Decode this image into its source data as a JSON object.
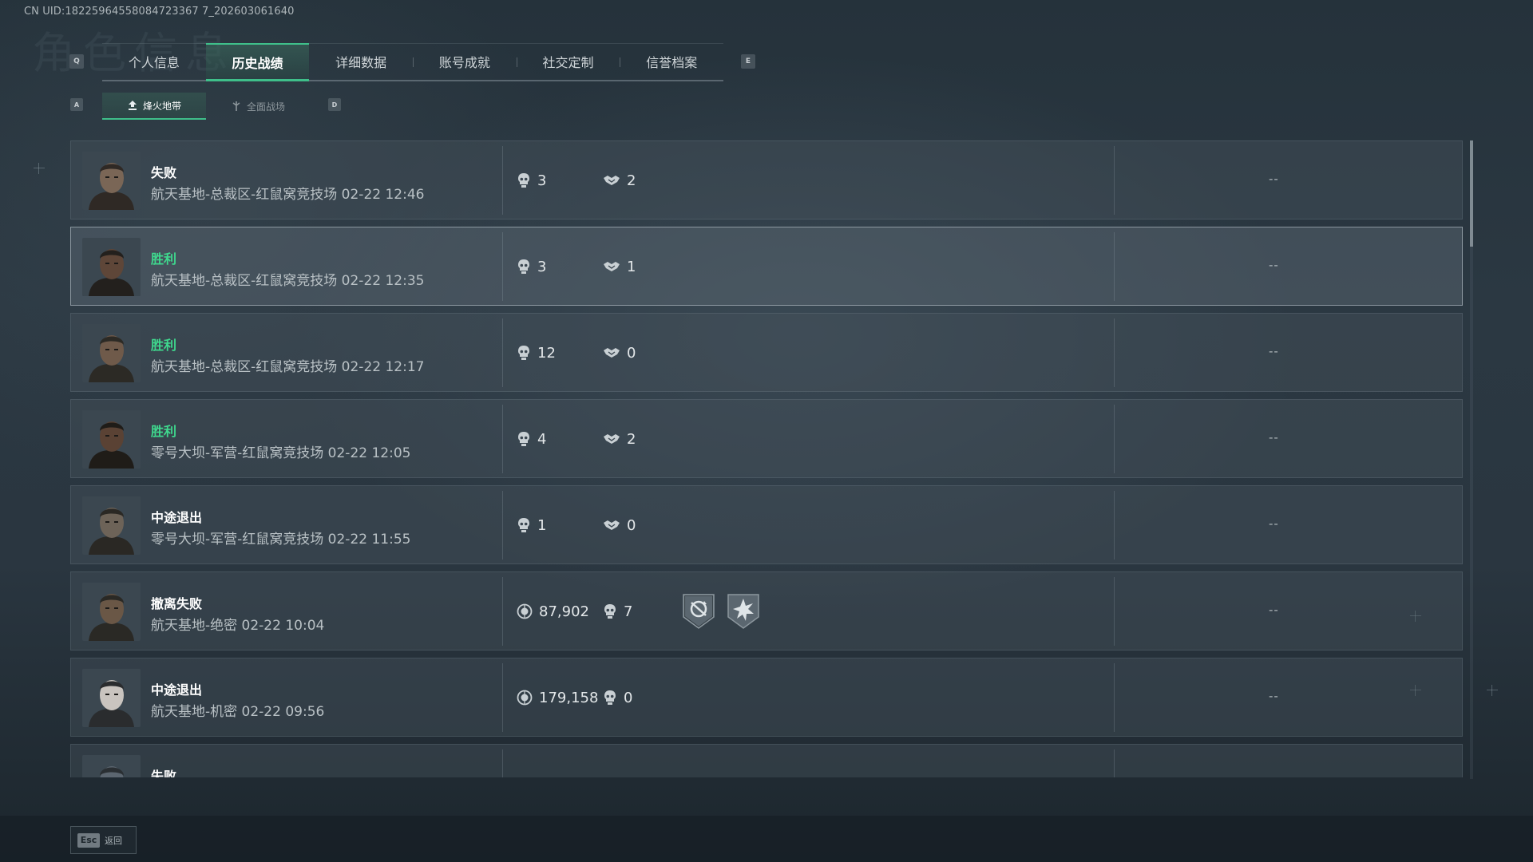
{
  "uid": "CN UID:18225964558084723367 7_202603061640",
  "watermark": "角色信息",
  "keys": {
    "prev_tab": "Q",
    "next_tab": "E",
    "prev_sub": "A",
    "next_sub": "D"
  },
  "tabs": [
    {
      "label": "个人信息"
    },
    {
      "label": "历史战绩"
    },
    {
      "label": "详细数据"
    },
    {
      "label": "账号成就"
    },
    {
      "label": "社交定制"
    },
    {
      "label": "信誉档案"
    }
  ],
  "active_tab_index": 1,
  "subtabs": [
    {
      "label": "烽火地带",
      "icon": "flame-zone-icon"
    },
    {
      "label": "全面战场",
      "icon": "battlefield-icon"
    }
  ],
  "active_subtab_index": 0,
  "colors": {
    "accent": "#3fbf8a",
    "win": "#3fd98e"
  },
  "matches": [
    {
      "result": "失败",
      "win": false,
      "meta": "航天基地-总裁区-红鼠窝竞技场 02-22 12:46",
      "stat1_icon": "skull-icon",
      "stat1": "3",
      "stat2_icon": "handshake-icon",
      "stat2": "2",
      "extra": "--",
      "highlighted": false
    },
    {
      "result": "胜利",
      "win": true,
      "meta": "航天基地-总裁区-红鼠窝竞技场 02-22 12:35",
      "stat1_icon": "skull-icon",
      "stat1": "3",
      "stat2_icon": "handshake-icon",
      "stat2": "1",
      "extra": "--",
      "highlighted": true
    },
    {
      "result": "胜利",
      "win": true,
      "meta": "航天基地-总裁区-红鼠窝竞技场 02-22 12:17",
      "stat1_icon": "skull-icon",
      "stat1": "12",
      "stat2_icon": "handshake-icon",
      "stat2": "0",
      "extra": "--",
      "highlighted": false
    },
    {
      "result": "胜利",
      "win": true,
      "meta": "零号大坝-军营-红鼠窝竞技场 02-22 12:05",
      "stat1_icon": "skull-icon",
      "stat1": "4",
      "stat2_icon": "handshake-icon",
      "stat2": "2",
      "extra": "--",
      "highlighted": false
    },
    {
      "result": "中途退出",
      "win": false,
      "meta": "零号大坝-军营-红鼠窝竞技场 02-22 11:55",
      "stat1_icon": "skull-icon",
      "stat1": "1",
      "stat2_icon": "handshake-icon",
      "stat2": "0",
      "extra": "--",
      "highlighted": false
    },
    {
      "result": "撤离失败",
      "win": false,
      "meta": "航天基地-绝密 02-22 10:04",
      "stat1_icon": "coin-icon",
      "stat1": "87,902",
      "stat2_icon": "skull-icon",
      "stat2": "7",
      "extra": "--",
      "highlighted": false,
      "badges": [
        "rotation-badge-icon",
        "burst-badge-icon"
      ]
    },
    {
      "result": "中途退出",
      "win": false,
      "meta": "航天基地-机密 02-22 09:56",
      "stat1_icon": "coin-icon",
      "stat1": "179,158",
      "stat2_icon": "skull-icon",
      "stat2": "0",
      "extra": "--",
      "highlighted": false
    },
    {
      "result": "失败",
      "win": false,
      "meta": "",
      "stat1_icon": "",
      "stat1": "",
      "stat2_icon": "",
      "stat2": "",
      "extra": "",
      "highlighted": false
    }
  ],
  "back": {
    "key": "Esc",
    "label": "返回"
  }
}
